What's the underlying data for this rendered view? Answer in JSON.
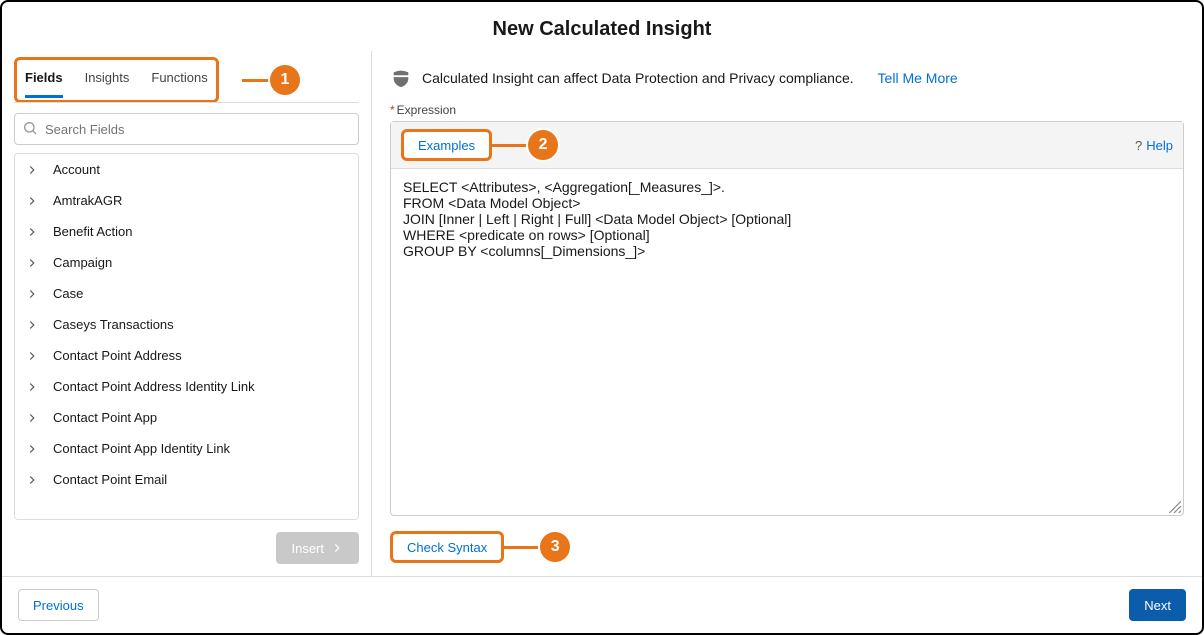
{
  "modal": {
    "title": "New Calculated Insight"
  },
  "tabs": {
    "fields": "Fields",
    "insights": "Insights",
    "functions": "Functions"
  },
  "search": {
    "placeholder": "Search Fields"
  },
  "fields": [
    "Account",
    "AmtrakAGR",
    "Benefit Action",
    "Campaign",
    "Case",
    "Caseys Transactions",
    "Contact Point Address",
    "Contact Point Address Identity Link",
    "Contact Point App",
    "Contact Point App Identity Link",
    "Contact Point Email"
  ],
  "buttons": {
    "insert": "Insert",
    "examples": "Examples",
    "check_syntax": "Check Syntax",
    "previous": "Previous",
    "next": "Next",
    "help": "Help",
    "tell_me_more": "Tell Me More"
  },
  "notice": {
    "text": "Calculated Insight can affect Data Protection and Privacy compliance."
  },
  "expression": {
    "label": "Expression",
    "template": "SELECT <Attributes>, <Aggregation[_Measures_]>.\nFROM <Data Model Object>\nJOIN [Inner | Left | Right | Full] <Data Model Object> [Optional]\nWHERE <predicate on rows> [Optional]\nGROUP BY <columns[_Dimensions_]>"
  },
  "callouts": {
    "one": "1",
    "two": "2",
    "three": "3"
  }
}
